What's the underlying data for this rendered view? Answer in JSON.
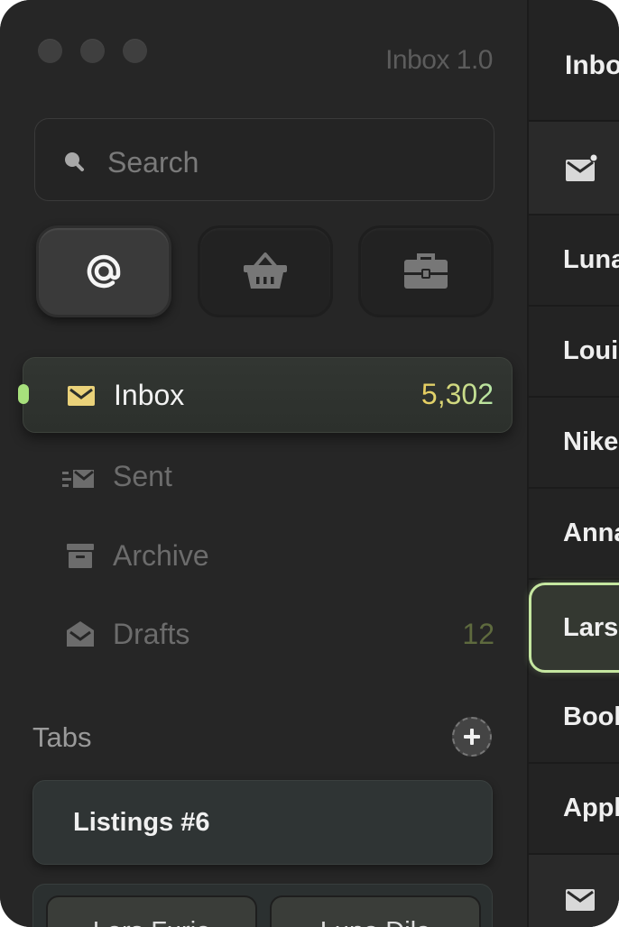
{
  "app": {
    "title": "Inbox 1.0"
  },
  "search": {
    "placeholder": "Search"
  },
  "accounts": [
    {
      "icon": "at-icon",
      "active": true
    },
    {
      "icon": "basket-icon",
      "active": false
    },
    {
      "icon": "briefcase-icon",
      "active": false
    }
  ],
  "nav": {
    "inbox": {
      "label": "Inbox",
      "count": "5,302"
    },
    "sent": {
      "label": "Sent"
    },
    "archive": {
      "label": "Archive"
    },
    "drafts": {
      "label": "Drafts",
      "count": "12"
    }
  },
  "tabs": {
    "heading": "Tabs",
    "items": [
      {
        "label": "Listings #6"
      },
      {
        "label": "Lars Furio"
      },
      {
        "label": "Luna Dila"
      }
    ]
  },
  "list": {
    "header": "Inbox",
    "rows": [
      {
        "name": "Luna"
      },
      {
        "name": "Louis"
      },
      {
        "name": "Nike"
      },
      {
        "name": "Anna"
      },
      {
        "name": "Lars"
      },
      {
        "name": "Book"
      },
      {
        "name": "Apple"
      }
    ]
  },
  "colors": {
    "accent": "#a7e07c",
    "count_gold": "#e9cd5e",
    "selected_border": "#c5e6a0"
  }
}
